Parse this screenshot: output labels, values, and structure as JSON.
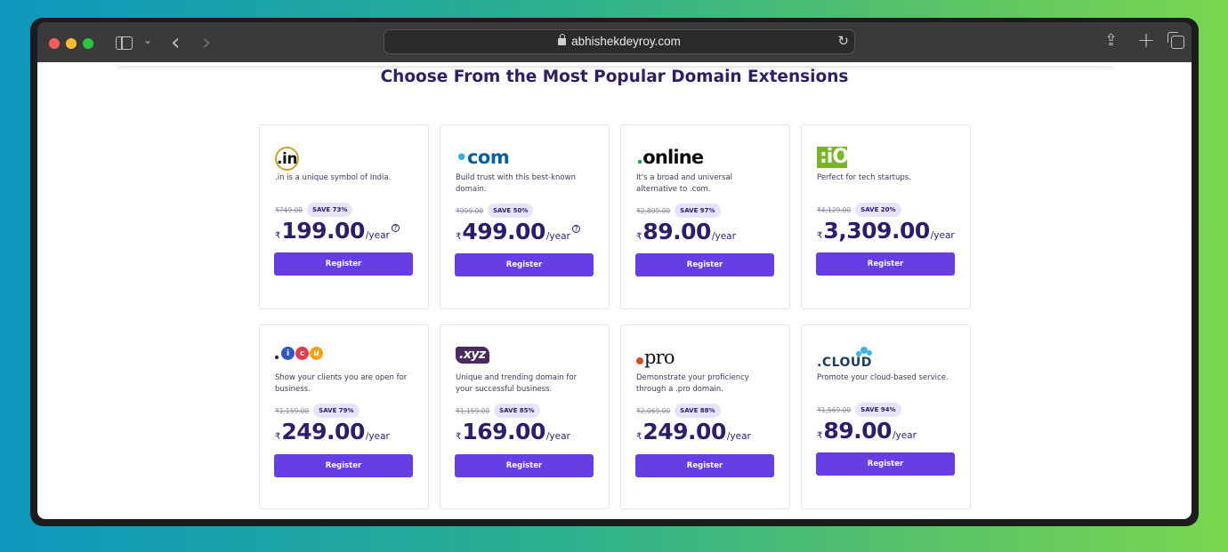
{
  "browser": {
    "url": "abhishekdeyroy.com"
  },
  "page": {
    "heading": "Choose From the Most Popular Domain Extensions"
  },
  "cards": [
    {
      "logo": ".in",
      "logo_icon": "in-domain-logo",
      "description": ".in is a unique symbol of India.",
      "old_price": "₹749.00",
      "save": "SAVE 73%",
      "currency": "₹",
      "price": "199.00",
      "per": "/year",
      "help": true,
      "button": "Register"
    },
    {
      "logo": ".com",
      "logo_icon": "com-domain-logo",
      "description": "Build trust with this best-known domain.",
      "old_price": "₹999.00",
      "save": "SAVE 50%",
      "currency": "₹",
      "price": "499.00",
      "per": "/year",
      "help": true,
      "button": "Register"
    },
    {
      "logo": ".online",
      "logo_icon": "online-domain-logo",
      "description": "It's a broad and universal alternative to .com.",
      "old_price": "₹2,899.00",
      "save": "SAVE 97%",
      "currency": "₹",
      "price": "89.00",
      "per": "/year",
      "help": false,
      "button": "Register"
    },
    {
      "logo": ".iO",
      "logo_icon": "io-domain-logo",
      "description": "Perfect for tech startups.",
      "old_price": "₹4,129.00",
      "save": "SAVE 20%",
      "currency": "₹",
      "price": "3,309.00",
      "per": "/year",
      "help": false,
      "button": "Register"
    },
    {
      "logo": "icu",
      "logo_icon": "icu-domain-logo",
      "description": "Show your clients you are open for business.",
      "old_price": "₹1,159.00",
      "save": "SAVE 79%",
      "currency": "₹",
      "price": "249.00",
      "per": "/year",
      "help": false,
      "button": "Register"
    },
    {
      "logo": ".xyz",
      "logo_icon": "xyz-domain-logo",
      "description": "Unique and trending domain for your successful business.",
      "old_price": "₹1,159.00",
      "save": "SAVE 85%",
      "currency": "₹",
      "price": "169.00",
      "per": "/year",
      "help": false,
      "button": "Register"
    },
    {
      "logo": "pro",
      "logo_icon": "pro-domain-logo",
      "description": "Demonstrate your proficiency through a .pro domain.",
      "old_price": "₹2,069.00",
      "save": "SAVE 88%",
      "currency": "₹",
      "price": "249.00",
      "per": "/year",
      "help": false,
      "button": "Register"
    },
    {
      "logo": ".CLOUD",
      "logo_icon": "cloud-domain-logo",
      "description": "Promote your cloud-based service.",
      "old_price": "₹1,569.00",
      "save": "SAVE 94%",
      "currency": "₹",
      "price": "89.00",
      "per": "/year",
      "help": false,
      "button": "Register"
    }
  ],
  "colors": {
    "accent": "#673de6",
    "heading": "#2f1c6a",
    "badge_bg": "#e7e3fb"
  }
}
